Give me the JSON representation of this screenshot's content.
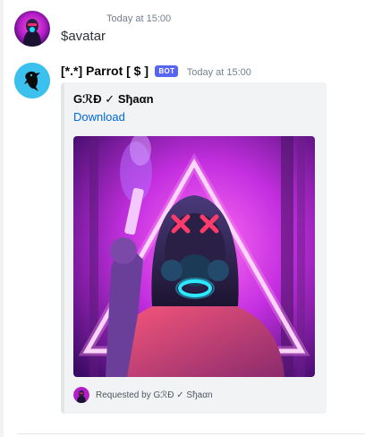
{
  "messages": [
    {
      "author": "",
      "timestamp": "Today at 15:00",
      "text": "$avatar",
      "avatar_icon": "neon-mask-avatar"
    },
    {
      "author": "[*.*] Parrot [ $ ]",
      "bot_tag": "BOT",
      "timestamp": "Today at 15:00",
      "avatar_icon": "parrot-avatar",
      "embed": {
        "title": "GℛĐ ✓ Sђaαn",
        "link_label": "Download",
        "image_icon": "neon-mask-image",
        "footer_text": "Requested by GℛĐ ✓ Sђaαn"
      }
    }
  ],
  "colors": {
    "bot_tag": "#5865f2",
    "link": "#0068e0",
    "embed_bg": "#f2f3f5",
    "parrot_avatar_bg": "#3cc0ee"
  }
}
